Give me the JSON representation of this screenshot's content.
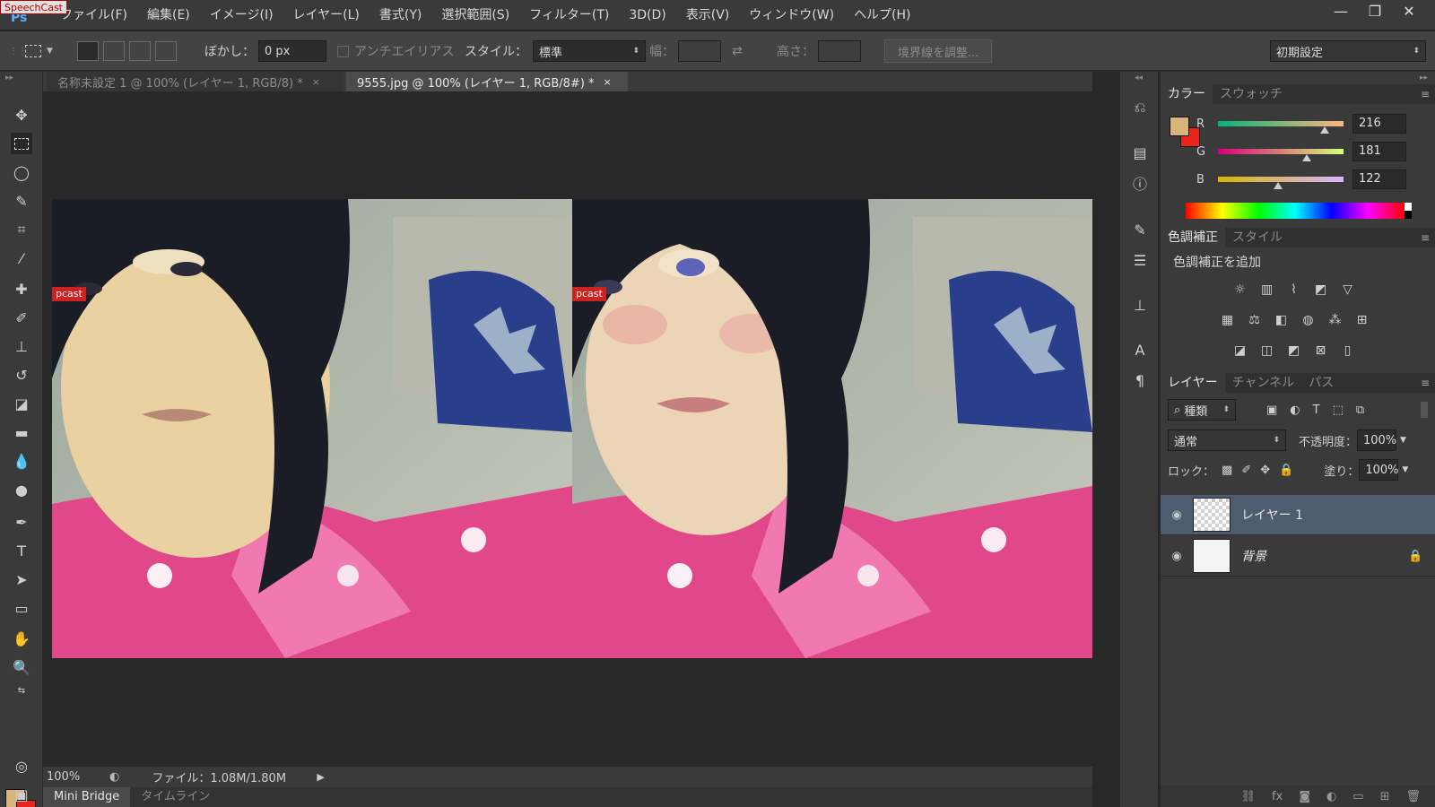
{
  "badge": "SpeechCast",
  "app_logo": "Ps",
  "menu": [
    "ファイル(F)",
    "編集(E)",
    "イメージ(I)",
    "レイヤー(L)",
    "書式(Y)",
    "選択範囲(S)",
    "フィルター(T)",
    "3D(D)",
    "表示(V)",
    "ウィンドウ(W)",
    "ヘルプ(H)"
  ],
  "window_controls": [
    "—",
    "❐",
    "✕"
  ],
  "options": {
    "feather_label": "ぼかし：",
    "feather_value": "0 px",
    "antialias_label": "アンチエイリアス",
    "style_label": "スタイル：",
    "style_value": "標準",
    "width_label": "幅：",
    "height_label": "高さ：",
    "refine_button": "境界線を調整...",
    "workspace": "初期設定"
  },
  "doc_tabs": [
    {
      "label": "名称未設定 1 @ 100% (レイヤー 1, RGB/8) *",
      "close": "×"
    },
    {
      "label": "9555.jpg @ 100% (レイヤー 1, RGB/8#) *",
      "close": "×"
    }
  ],
  "canvas": {
    "watermark": "pcast"
  },
  "status": {
    "zoom": "100%",
    "file_info": "ファイル：1.08M/1.80M",
    "arrow": "▶"
  },
  "bottom_tabs": [
    "Mini Bridge",
    "タイムライン"
  ],
  "color_panel": {
    "tabs": [
      "カラー",
      "スウォッチ"
    ],
    "fg": "#d8b57a",
    "bg": "#e8241c",
    "channels": [
      {
        "name": "R",
        "value": 216,
        "value_text": "216"
      },
      {
        "name": "G",
        "value": 181,
        "value_text": "181"
      },
      {
        "name": "B",
        "value": 122,
        "value_text": "122"
      }
    ]
  },
  "adjust_panel": {
    "tabs": [
      "色調補正",
      "スタイル"
    ],
    "title": "色調補正を追加"
  },
  "layers_panel": {
    "tabs": [
      "レイヤー",
      "チャンネル",
      "パス"
    ],
    "filter_kind": "種類",
    "blend_mode": "通常",
    "opacity_label": "不透明度：",
    "opacity_value": "100%",
    "lock_label": "ロック：",
    "fill_label": "塗り：",
    "fill_value": "100%",
    "layers": [
      {
        "name": "レイヤー 1",
        "selected": true
      },
      {
        "name": "背景",
        "selected": false
      }
    ]
  }
}
